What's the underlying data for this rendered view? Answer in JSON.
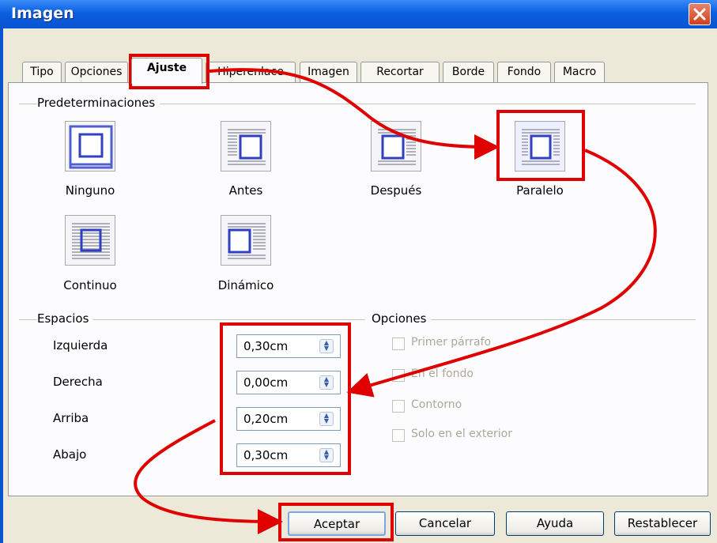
{
  "window": {
    "title": "Imagen",
    "close_icon": "close-icon"
  },
  "tabs": [
    {
      "label": "Tipo"
    },
    {
      "label": "Opciones"
    },
    {
      "label": "Ajuste",
      "active": true
    },
    {
      "label": "Hiperenlace"
    },
    {
      "label": "Imagen"
    },
    {
      "label": "Recortar"
    },
    {
      "label": "Borde"
    },
    {
      "label": "Fondo"
    },
    {
      "label": "Macro"
    }
  ],
  "presets": {
    "title": "Predeterminaciones",
    "items": [
      {
        "label": "Ninguno",
        "icon": "wrap-none-icon"
      },
      {
        "label": "Antes",
        "icon": "wrap-before-icon"
      },
      {
        "label": "Después",
        "icon": "wrap-after-icon"
      },
      {
        "label": "Paralelo",
        "icon": "wrap-parallel-icon",
        "selected": true
      },
      {
        "label": "Continuo",
        "icon": "wrap-through-icon"
      },
      {
        "label": "Dinámico",
        "icon": "wrap-optimal-icon"
      }
    ]
  },
  "spacing": {
    "title": "Espacios",
    "rows": [
      {
        "label": "Izquierda",
        "value": "0,30cm"
      },
      {
        "label": "Derecha",
        "value": "0,00cm"
      },
      {
        "label": "Arriba",
        "value": "0,20cm"
      },
      {
        "label": "Abajo",
        "value": "0,30cm"
      }
    ]
  },
  "options": {
    "title": "Opciones",
    "items": [
      {
        "label": "Primer párrafo",
        "checked": false,
        "enabled": false
      },
      {
        "label": "En el fondo",
        "checked": false,
        "enabled": false
      },
      {
        "label": "Contorno",
        "checked": false,
        "enabled": false
      },
      {
        "label": "Solo en el exterior",
        "checked": false,
        "enabled": false
      }
    ]
  },
  "buttons": {
    "ok": "Aceptar",
    "cancel": "Cancelar",
    "help": "Ayuda",
    "reset": "Restablecer"
  },
  "colors": {
    "title_bar": "#0a54d2",
    "annotation": "#e00000"
  }
}
